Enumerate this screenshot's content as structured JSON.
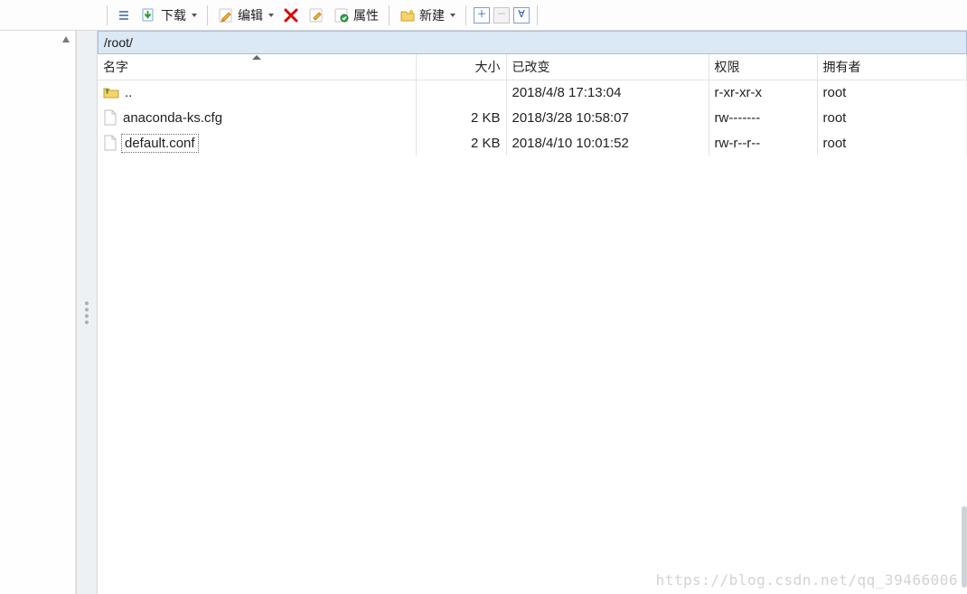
{
  "toolbar": {
    "download": "下载",
    "edit": "编辑",
    "properties": "属性",
    "new": "新建"
  },
  "path": "/root/",
  "columns": {
    "name": "名字",
    "size": "大小",
    "changed": "已改变",
    "rights": "权限",
    "owner": "拥有者"
  },
  "rows": [
    {
      "icon": "parent",
      "name": "..",
      "size": "",
      "changed": "2018/4/8 17:13:04",
      "rights": "r-xr-xr-x",
      "owner": "root",
      "selected": false
    },
    {
      "icon": "file",
      "name": "anaconda-ks.cfg",
      "size": "2 KB",
      "changed": "2018/3/28 10:58:07",
      "rights": "rw-------",
      "owner": "root",
      "selected": false
    },
    {
      "icon": "file",
      "name": "default.conf",
      "size": "2 KB",
      "changed": "2018/4/10 10:01:52",
      "rights": "rw-r--r--",
      "owner": "root",
      "selected": true
    }
  ],
  "watermark": "https://blog.csdn.net/qq_39466006"
}
